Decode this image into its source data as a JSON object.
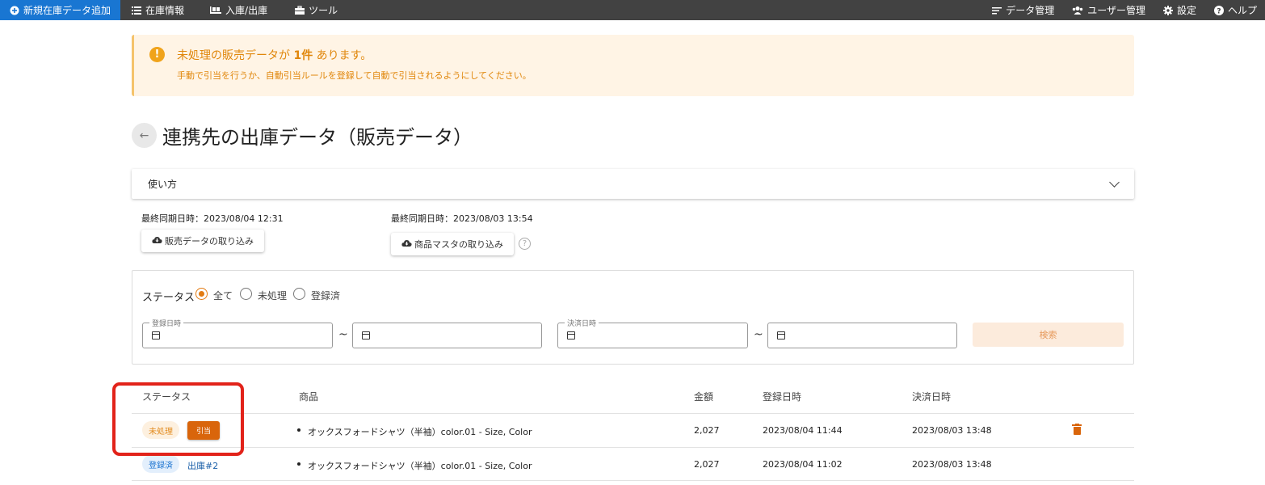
{
  "nav": {
    "new_stock": "新規在庫データ追加",
    "inventory": "在庫情報",
    "in_out": "入庫/出庫",
    "tools": "ツール",
    "data_mgmt": "データ管理",
    "user_mgmt": "ユーザー管理",
    "settings": "設定",
    "help": "ヘルプ"
  },
  "alert": {
    "title_prefix": "未処理の販売データが",
    "title_count": "1件",
    "title_suffix": "あります。",
    "message": "手動で引当を行うか、自動引当ルールを登録して自動で引当されるようにしてください。"
  },
  "page": {
    "title": "連携先の出庫データ（販売データ）",
    "back_icon": "←"
  },
  "howto": {
    "label": "使い方"
  },
  "sync": {
    "sales_last": "最終同期日時：2023/08/04 12:31",
    "sales_button": "販売データの取り込み",
    "master_last": "最終同期日時：2023/08/03 13:54",
    "master_button": "商品マスタの取り込み",
    "help_icon": "?"
  },
  "filter": {
    "status_label": "ステータス",
    "options": [
      "全て",
      "未処理",
      "登録済"
    ],
    "selected": "全て",
    "registered_label": "登録日時",
    "settled_label": "決済日時",
    "tilde": "~",
    "search_button": "検索"
  },
  "table": {
    "headers": [
      "ステータス",
      "商品",
      "金額",
      "登録日時",
      "決済日時"
    ],
    "rows": [
      {
        "status": "未処理",
        "action": "引当",
        "product": "オックスフォードシャツ（半袖）color.01 - Size, Color",
        "amount": "2,027",
        "registered": "2023/08/04 11:44",
        "settled": "2023/08/03 13:48"
      },
      {
        "status": "登録済",
        "action": "出庫#2",
        "product": "オックスフォードシャツ（半袖）color.01 - Size, Color",
        "amount": "2,027",
        "registered": "2023/08/04 11:02",
        "settled": "2023/08/03 13:48"
      }
    ]
  },
  "colors": {
    "nav_bg": "#424242",
    "primary": "#1976d2",
    "accent": "#d9650b",
    "warning_bg": "#fff4e5",
    "highlight": "#e2231a"
  }
}
